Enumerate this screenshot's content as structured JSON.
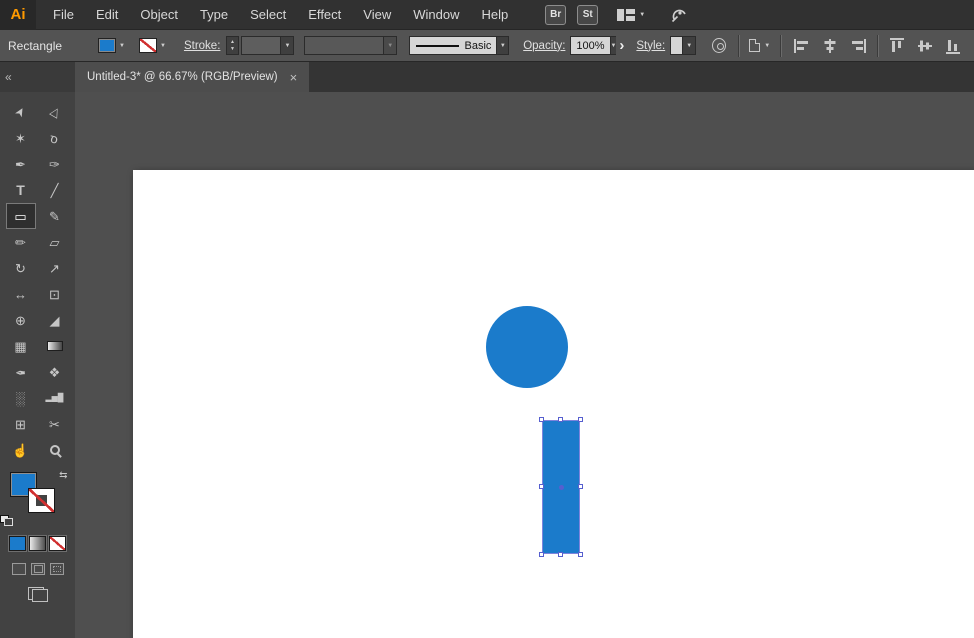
{
  "menubar": {
    "app_logo": "Ai",
    "items": [
      "File",
      "Edit",
      "Object",
      "Type",
      "Select",
      "Effect",
      "View",
      "Window",
      "Help"
    ],
    "bridge_badge": "Br",
    "stock_badge": "St"
  },
  "controlbar": {
    "context_label": "Rectangle",
    "stroke_label": "Stroke:",
    "brush_definition": "Basic",
    "opacity_label": "Opacity:",
    "opacity_value": "100%",
    "style_label": "Style:"
  },
  "tab_row": {
    "collapse_glyph": "«",
    "title": "Untitled-3* @ 66.67% (RGB/Preview)",
    "close_glyph": "×"
  },
  "tools": [
    {
      "name": "selection-tool",
      "glyph": "➤"
    },
    {
      "name": "direct-selection-tool",
      "glyph": "▷"
    },
    {
      "name": "magic-wand-tool",
      "glyph": "✶"
    },
    {
      "name": "lasso-tool",
      "glyph": "σ"
    },
    {
      "name": "pen-tool",
      "glyph": "✒"
    },
    {
      "name": "curvature-tool",
      "glyph": "✑"
    },
    {
      "name": "type-tool",
      "glyph": "T"
    },
    {
      "name": "line-segment-tool",
      "glyph": "╱"
    },
    {
      "name": "rectangle-tool",
      "glyph": "▭",
      "selected": true
    },
    {
      "name": "paintbrush-tool",
      "glyph": "✎"
    },
    {
      "name": "pencil-tool",
      "glyph": "✏"
    },
    {
      "name": "eraser-tool",
      "glyph": "▱"
    },
    {
      "name": "rotate-tool",
      "glyph": "↻"
    },
    {
      "name": "scale-tool",
      "glyph": "↗"
    },
    {
      "name": "width-tool",
      "glyph": "↔"
    },
    {
      "name": "free-transform-tool",
      "glyph": "⊡"
    },
    {
      "name": "shape-builder-tool",
      "glyph": "⊕"
    },
    {
      "name": "perspective-grid-tool",
      "glyph": "◢"
    },
    {
      "name": "mesh-tool",
      "glyph": "▦"
    },
    {
      "name": "gradient-tool",
      "glyph": ""
    },
    {
      "name": "eyedropper-tool",
      "glyph": "✒"
    },
    {
      "name": "blend-tool",
      "glyph": "❖"
    },
    {
      "name": "symbol-sprayer-tool",
      "glyph": "░"
    },
    {
      "name": "column-graph-tool",
      "glyph": "▂▅█"
    },
    {
      "name": "artboard-tool",
      "glyph": "⊞"
    },
    {
      "name": "slice-tool",
      "glyph": "✂"
    },
    {
      "name": "hand-tool",
      "glyph": "☝"
    },
    {
      "name": "zoom-tool",
      "glyph": ""
    }
  ],
  "colors": {
    "shape_blue": "#1B7BCB",
    "selection_accent": "#565FCF",
    "artboard": "#FFFFFF",
    "logo_orange": "#FF9A00"
  }
}
